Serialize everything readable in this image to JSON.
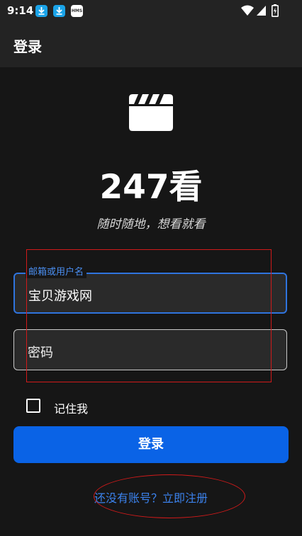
{
  "status_bar": {
    "time": "9:14",
    "icons": [
      "download-icon",
      "download-icon",
      "hms-icon",
      "wifi-icon",
      "signal-icon",
      "battery-icon"
    ],
    "hms_text": "HMS"
  },
  "app_bar": {
    "title": "登录"
  },
  "brand": {
    "icon": "clapperboard-icon",
    "name": "247看",
    "tagline": "随时随地，想看就看"
  },
  "form": {
    "email": {
      "label": "邮箱或用户名",
      "value": "宝贝游戏网"
    },
    "password": {
      "placeholder": "密码"
    },
    "remember_me": {
      "label": "记住我",
      "checked": false
    },
    "login_button": "登录",
    "register_link": "还没有账号？立即注册"
  },
  "colors": {
    "background": "#161616",
    "bar": "#232323",
    "accent": "#0a63e6",
    "link": "#3b82ec",
    "annotation": "#d01a1a"
  }
}
